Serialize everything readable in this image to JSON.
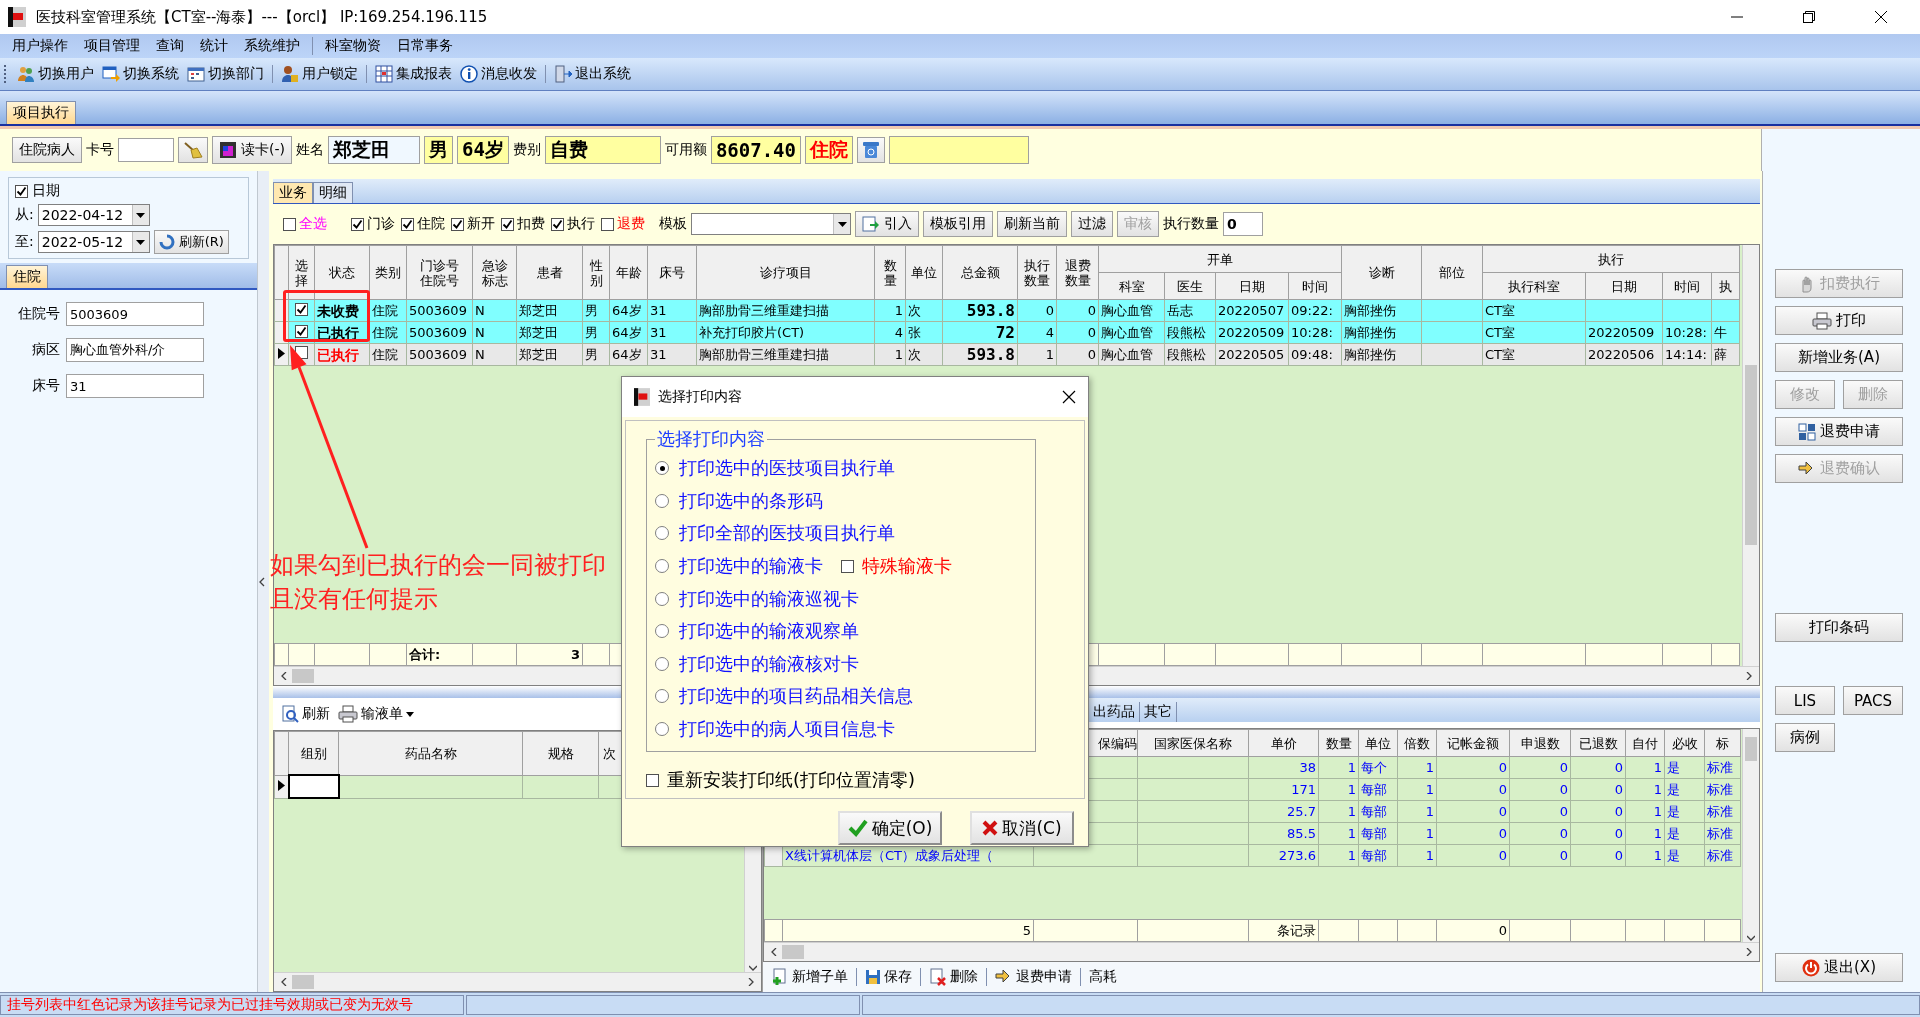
{
  "window": {
    "title": "医技科室管理系统【CT室--海泰】---【orcl】 IP:169.254.196.115"
  },
  "menu": [
    [
      "用户操作",
      "项目管理",
      "查询",
      "统计",
      "系统维护"
    ],
    [
      "科室物资",
      "日常事务"
    ]
  ],
  "toolbar": [
    [
      "切换用户",
      "切换系统",
      "切换部门"
    ],
    [
      "用户锁定"
    ],
    [
      "集成报表",
      "消息收发"
    ],
    [
      "退出系统"
    ]
  ],
  "page_tabs": [
    {
      "label": "项目执行",
      "selected": true
    }
  ],
  "patient": {
    "type_button": "住院病人",
    "card_label": "卡号",
    "read_card_button": "读卡(-)",
    "name_label": "姓名",
    "name": "郑芝田",
    "sex": "男",
    "age": "64岁",
    "fee_label": "费别",
    "fee_type": "自费",
    "balance_label": "可用额",
    "balance": "8607.40",
    "visit_type": "住院"
  },
  "left_panel": {
    "date_filter": {
      "label": "日期",
      "checked": true,
      "from_label": "从:",
      "from": "2022-04-12",
      "to_label": "至:",
      "to": "2022-05-12",
      "refresh_button": "刷新(R)"
    },
    "tabs": [
      {
        "label": "住院",
        "selected": true
      }
    ],
    "fields": [
      {
        "label": "住院号",
        "value": "5003609"
      },
      {
        "label": "病区",
        "value": "胸心血管外科/介"
      },
      {
        "label": "床号",
        "value": "31"
      }
    ]
  },
  "business_tabs": [
    {
      "label": "业务",
      "selected": true
    },
    {
      "label": "明细",
      "selected": false
    }
  ],
  "filters": [
    {
      "label": "全选",
      "checked": false,
      "kind": "select_all"
    },
    {
      "label": "门诊",
      "checked": true,
      "kind": "type"
    },
    {
      "label": "住院",
      "checked": true,
      "kind": "type"
    },
    {
      "label": "新开",
      "checked": true,
      "kind": "type"
    },
    {
      "label": "扣费",
      "checked": true,
      "kind": "type"
    },
    {
      "label": "执行",
      "checked": true,
      "kind": "type"
    },
    {
      "label": "退费",
      "checked": false,
      "kind": "refund"
    }
  ],
  "template_label": "模板",
  "filter_buttons": [
    {
      "label": "引入",
      "disabled": false
    },
    {
      "label": "模板引用",
      "disabled": false
    },
    {
      "label": "刷新当前",
      "disabled": false
    },
    {
      "label": "过滤",
      "disabled": false
    },
    {
      "label": "审核",
      "disabled": true
    }
  ],
  "exec_count": {
    "label": "执行数量",
    "value": "0"
  },
  "main_table": {
    "header": [
      {
        "label": "选择"
      },
      {
        "label": "状态"
      },
      {
        "label": "类别"
      },
      {
        "label": "门诊号住院号"
      },
      {
        "label": "急诊标志"
      },
      {
        "label": "患者"
      },
      {
        "label": "性别"
      },
      {
        "label": "年龄"
      },
      {
        "label": "床号"
      },
      {
        "label": "诊疗项目"
      },
      {
        "label": "数量"
      },
      {
        "label": "单位"
      },
      {
        "label": "总金额"
      },
      {
        "label": "执行数量"
      },
      {
        "label": "退费数量"
      },
      {
        "label": "开单",
        "children": [
          {
            "label": "科室"
          },
          {
            "label": "医生"
          },
          {
            "label": "日期"
          },
          {
            "label": "时间"
          }
        ]
      },
      {
        "label": "诊断"
      },
      {
        "label": "部位"
      },
      {
        "label": "执行",
        "children": [
          {
            "label": "执行科室"
          },
          {
            "label": "日期"
          },
          {
            "label": "时间"
          },
          {
            "label": "执"
          }
        ]
      }
    ],
    "rows": [
      {
        "selected": true,
        "current": false,
        "checked": true,
        "color": "#000000",
        "cells": [
          "未收费",
          "住院",
          "5003609",
          "N",
          "郑芝田",
          "男",
          "64岁",
          "31",
          "胸部肋骨三维重建扫描",
          "1",
          "次",
          "593.8",
          "0",
          "0",
          "胸心血管",
          "岳志",
          "20220507",
          "09:22:",
          "胸部挫伤",
          null,
          "CT室",
          null,
          null,
          null
        ]
      },
      {
        "selected": true,
        "current": false,
        "checked": true,
        "color": "#000000",
        "cells": [
          "已执行",
          "住院",
          "5003609",
          "N",
          "郑芝田",
          "男",
          "64岁",
          "31",
          "补充打印胶片(CT)",
          "4",
          "张",
          "72",
          "4",
          "0",
          "胸心血管",
          "段熊松",
          "20220509",
          "10:28:",
          "胸部挫伤",
          null,
          "CT室",
          "20220509",
          "10:28:",
          "牛"
        ]
      },
      {
        "selected": false,
        "current": true,
        "checked": false,
        "color": "#ff0000",
        "cells": [
          "已执行",
          "住院",
          "5003609",
          "N",
          "郑芝田",
          "男",
          "64岁",
          "31",
          "胸部肋骨三维重建扫描",
          "1",
          "次",
          "593.8",
          "1",
          "0",
          "胸心血管",
          "段熊松",
          "20220505",
          "09:48:",
          "胸部挫伤",
          null,
          "CT室",
          "20220506",
          "14:14:",
          "薛"
        ]
      }
    ],
    "total": {
      "label": "合计:",
      "count": "3"
    }
  },
  "annotation": {
    "text": "如果勾到已执行的会一同被打印且没有任何提示"
  },
  "lower_left": {
    "toolbar": [
      {
        "label": "刷新",
        "dropdown": false
      },
      {
        "label": "输液单",
        "dropdown": true
      }
    ],
    "columns": [
      "组别",
      "药品名称",
      "规格",
      "次"
    ]
  },
  "lower_right": {
    "tabs": [
      {
        "label": "出药品",
        "selected": false
      },
      {
        "label": "其它",
        "selected": false
      }
    ],
    "columns": [
      null,
      "保编码",
      "国家医保名称",
      "单价",
      "数量",
      "单位",
      "倍数",
      "记帐金额",
      "申退数",
      "已退数",
      "自付",
      "必收",
      "标"
    ],
    "rows": [
      {
        "cells": [
          null,
          null,
          null,
          "38",
          "1",
          "每个",
          "1",
          "0",
          "0",
          "0",
          "1",
          "是",
          "标准"
        ]
      },
      {
        "cells": [
          null,
          null,
          null,
          "171",
          "1",
          "每部",
          "1",
          "0",
          "0",
          "0",
          "1",
          "是",
          "标准"
        ]
      },
      {
        "cells": [
          null,
          null,
          null,
          "25.7",
          "1",
          "每部",
          "1",
          "0",
          "0",
          "0",
          "1",
          "是",
          "标准"
        ]
      },
      {
        "cells": [
          null,
          null,
          null,
          "85.5",
          "1",
          "每部",
          "1",
          "0",
          "0",
          "0",
          "1",
          "是",
          "标准"
        ]
      },
      {
        "cells": [
          "X线计算机体层（CT）成象后处理（",
          null,
          null,
          "273.6",
          "1",
          "每部",
          "1",
          "0",
          "0",
          "0",
          "1",
          "是",
          "标准"
        ]
      }
    ],
    "total": {
      "count": "5",
      "label": "条记录",
      "amount": "0"
    },
    "toolbar": [
      "新增子单",
      "保存",
      "删除",
      "退费申请",
      "高耗"
    ]
  },
  "right_panel": [
    [
      [
        {
          "label": "扣费执行",
          "disabled": true
        }
      ],
      [
        {
          "label": "打印",
          "disabled": false
        }
      ],
      [
        {
          "label": "新增业务(A)",
          "disabled": false
        }
      ],
      [
        {
          "label": "修改",
          "disabled": true
        },
        {
          "label": "删除",
          "disabled": true
        }
      ],
      [
        {
          "label": "退费申请",
          "disabled": false
        }
      ],
      [
        {
          "label": "退费确认",
          "disabled": true
        }
      ]
    ],
    [
      [
        {
          "label": "打印条码",
          "disabled": false
        }
      ]
    ],
    [
      [
        {
          "label": "LIS",
          "disabled": false
        },
        {
          "label": "PACS",
          "disabled": false
        }
      ],
      [
        {
          "label": "病例",
          "disabled": false
        }
      ]
    ],
    [
      [
        {
          "label": "退出(X)",
          "disabled": false
        }
      ]
    ]
  ],
  "dialog": {
    "title": "选择打印内容",
    "group_label": "选择打印内容",
    "options": [
      {
        "label": "打印选中的医技项目执行单",
        "selected": true
      },
      {
        "label": "打印选中的条形码",
        "selected": false
      },
      {
        "label": "打印全部的医技项目执行单",
        "selected": false
      },
      {
        "label": "打印选中的输液卡",
        "selected": false,
        "extra": {
          "label": "特殊输液卡",
          "checked": false
        }
      },
      {
        "label": "打印选中的输液巡视卡",
        "selected": false
      },
      {
        "label": "打印选中的输液观察单",
        "selected": false
      },
      {
        "label": "打印选中的输液核对卡",
        "selected": false
      },
      {
        "label": "打印选中的项目药品相关信息",
        "selected": false
      },
      {
        "label": "打印选中的病人项目信息卡",
        "selected": false
      }
    ],
    "reinstall": {
      "label": "重新安装打印纸(打印位置清零)",
      "checked": false
    },
    "buttons": [
      "确定(O)",
      "取消(C)"
    ]
  },
  "status_bar": {
    "message": "挂号列表中红色记录为该挂号记录为已过挂号效期或已变为无效号"
  }
}
